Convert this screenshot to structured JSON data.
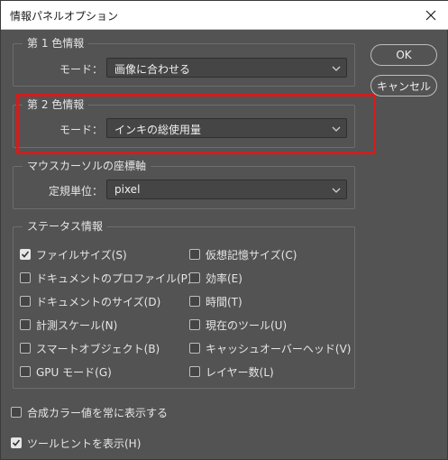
{
  "window": {
    "title": "情報パネルオプション"
  },
  "first_color": {
    "label": "第 1 色情報",
    "mode_label": "モード：",
    "mode_value": "画像に合わせる"
  },
  "second_color": {
    "label": "第 2 色情報",
    "mode_label": "モード：",
    "mode_value": "インキの総使用量"
  },
  "mouse_coords": {
    "label": "マウスカーソルの座標軸",
    "unit_label": "定規単位：",
    "unit_value": "pixel"
  },
  "status": {
    "label": "ステータス情報",
    "left": [
      {
        "label": "ファイルサイズ(S)",
        "checked": true
      },
      {
        "label": "ドキュメントのプロファイル(P)",
        "checked": false
      },
      {
        "label": "ドキュメントのサイズ(D)",
        "checked": false
      },
      {
        "label": "計測スケール(N)",
        "checked": false
      },
      {
        "label": "スマートオブジェクト(B)",
        "checked": false
      },
      {
        "label": "GPU モード(G)",
        "checked": false
      }
    ],
    "right": [
      {
        "label": "仮想記憶サイズ(C)",
        "checked": false
      },
      {
        "label": "効率(E)",
        "checked": false
      },
      {
        "label": "時間(T)",
        "checked": false
      },
      {
        "label": "現在のツール(U)",
        "checked": false
      },
      {
        "label": "キャッシュオーバーヘッド(V)",
        "checked": false
      },
      {
        "label": "レイヤー数(L)",
        "checked": false
      }
    ]
  },
  "options": {
    "composite": {
      "label": "合成カラー値を常に表示する",
      "checked": false
    },
    "tooltips": {
      "label": "ツールヒントを表示(H)",
      "checked": true
    }
  },
  "buttons": {
    "ok": "OK",
    "cancel": "キャンセル"
  },
  "colors": {
    "highlight": "#d41c1c",
    "background": "#535353"
  }
}
